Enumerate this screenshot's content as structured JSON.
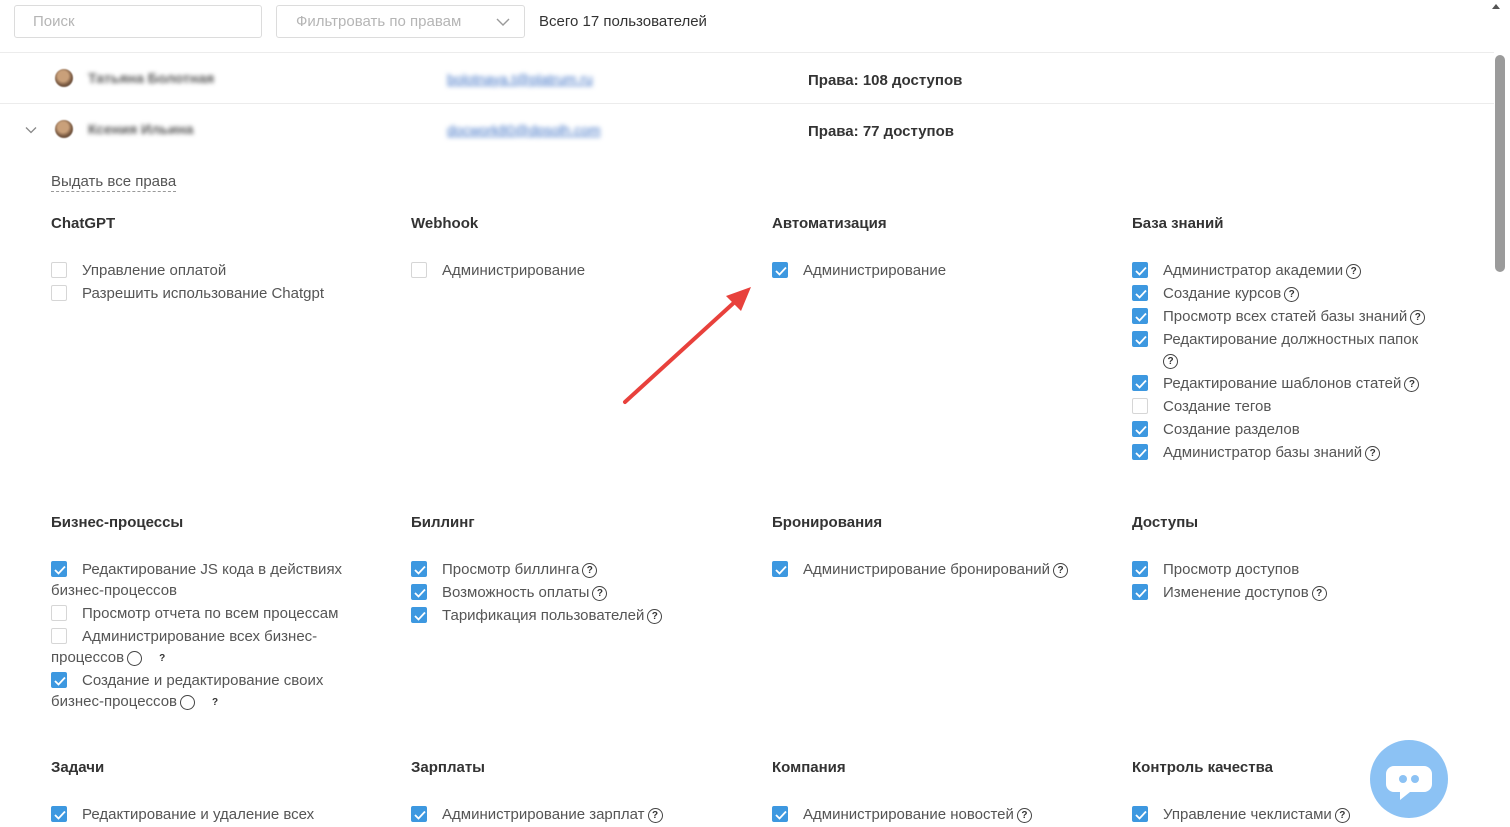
{
  "toolbar": {
    "search_placeholder": "Поиск",
    "filter_placeholder": "Фильтровать по правам",
    "total_label": "Всего 17 пользователей"
  },
  "users": [
    {
      "name": "Татьяна Болотная",
      "email": "bolotnaya.t@platrum.ru",
      "rights": "Права: 108 доступов"
    },
    {
      "name": "Ксения Ильина",
      "email": "docwork80@dpsolh.com",
      "rights": "Права: 77 доступов"
    }
  ],
  "grant_all_label": "Выдать все права",
  "groups": [
    {
      "title": "ChatGPT",
      "items": [
        {
          "label": "Управление оплатой",
          "checked": false,
          "help": false
        },
        {
          "label": "Разрешить использование Chatgpt",
          "checked": false,
          "help": false
        }
      ]
    },
    {
      "title": "Webhook",
      "items": [
        {
          "label": "Администрирование",
          "checked": false,
          "help": false
        }
      ]
    },
    {
      "title": "Автоматизация",
      "items": [
        {
          "label": "Администрирование",
          "checked": true,
          "help": false
        }
      ]
    },
    {
      "title": "База знаний",
      "items": [
        {
          "label": "Администратор академии",
          "checked": true,
          "help": true
        },
        {
          "label": "Создание курсов",
          "checked": true,
          "help": true
        },
        {
          "label": "Просмотр всех статей базы знаний",
          "checked": true,
          "help": true
        },
        {
          "label": "Редактирование должностных папок",
          "checked": true,
          "help": true
        },
        {
          "label": "Редактирование шаблонов статей",
          "checked": true,
          "help": true
        },
        {
          "label": "Создание тегов",
          "checked": false,
          "help": false
        },
        {
          "label": "Создание разделов",
          "checked": true,
          "help": false
        },
        {
          "label": "Администратор базы знаний",
          "checked": true,
          "help": true
        }
      ]
    },
    {
      "title": "Бизнес-процессы",
      "items": [
        {
          "label": "Редактирование JS кода в действиях бизнес-процессов",
          "checked": true,
          "help": false
        },
        {
          "label": "Просмотр отчета по всем процессам",
          "checked": false,
          "help": false
        },
        {
          "label": "Администрирование всех бизнес-процессов",
          "checked": false,
          "help": true
        },
        {
          "label": "Создание и редактирование своих бизнес-процессов",
          "checked": true,
          "help": true
        }
      ]
    },
    {
      "title": "Биллинг",
      "items": [
        {
          "label": "Просмотр биллинга",
          "checked": true,
          "help": true
        },
        {
          "label": "Возможность оплаты",
          "checked": true,
          "help": true
        },
        {
          "label": "Тарификация пользователей",
          "checked": true,
          "help": true
        }
      ]
    },
    {
      "title": "Бронирования",
      "items": [
        {
          "label": "Администрирование бронирований",
          "checked": true,
          "help": true
        }
      ]
    },
    {
      "title": "Доступы",
      "items": [
        {
          "label": "Просмотр доступов",
          "checked": true,
          "help": false
        },
        {
          "label": "Изменение доступов",
          "checked": true,
          "help": true
        }
      ]
    },
    {
      "title": "Задачи",
      "items": [
        {
          "label": "Редактирование и удаление всех",
          "checked": true,
          "help": false
        }
      ]
    },
    {
      "title": "Зарплаты",
      "items": [
        {
          "label": "Администрирование зарплат",
          "checked": true,
          "help": true
        }
      ]
    },
    {
      "title": "Компания",
      "items": [
        {
          "label": "Администрирование новостей",
          "checked": true,
          "help": true
        }
      ]
    },
    {
      "title": "Контроль качества",
      "items": [
        {
          "label": "Управление чеклистами",
          "checked": true,
          "help": true
        }
      ]
    }
  ],
  "help_glyph": "?",
  "colors": {
    "accent": "#3d98e0",
    "arrow": "#e8413c",
    "chat": "#8cc2f4"
  }
}
